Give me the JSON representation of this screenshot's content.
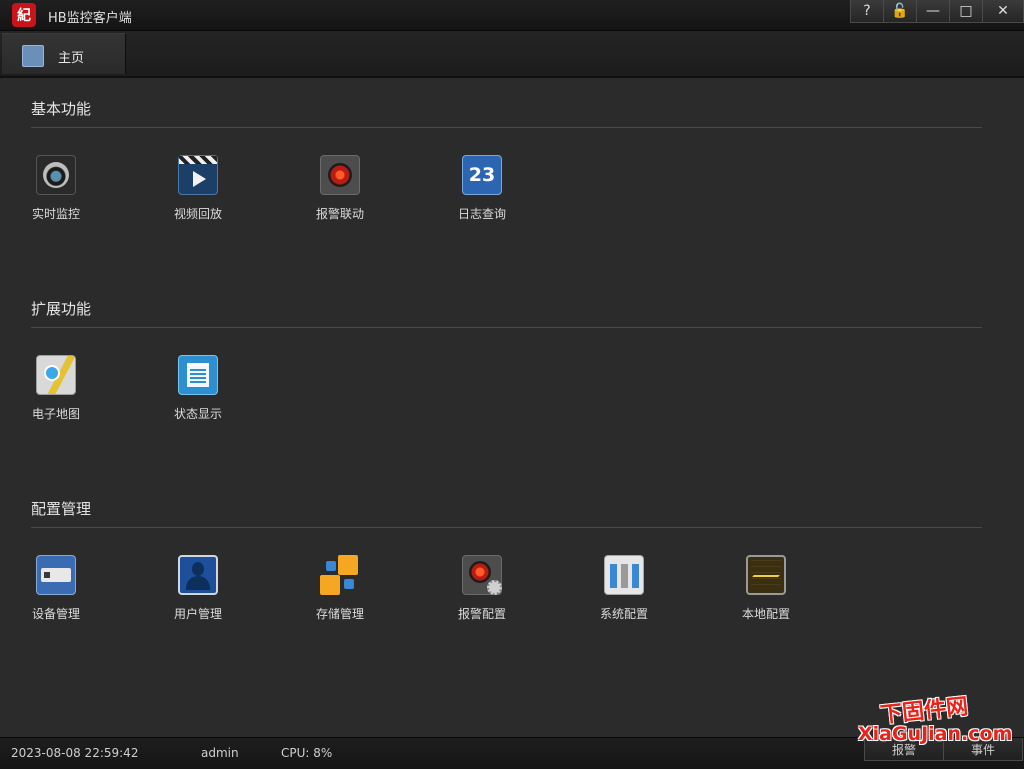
{
  "window": {
    "logo_text": "紀",
    "title": "HB监控客户端",
    "controls": [
      "?",
      "🔓",
      "—",
      "□",
      "✕"
    ]
  },
  "tabs": [
    {
      "label": "主页",
      "icon": "home-icon"
    }
  ],
  "sections": [
    {
      "title": "基本功能",
      "items": [
        {
          "label": "实时监控",
          "icon": "camera-icon"
        },
        {
          "label": "视频回放",
          "icon": "video-playback-icon"
        },
        {
          "label": "报警联动",
          "icon": "alarm-icon"
        },
        {
          "label": "日志查询",
          "icon": "calendar-icon",
          "icon_text": "23"
        }
      ]
    },
    {
      "title": "扩展功能",
      "items": [
        {
          "label": "电子地图",
          "icon": "map-icon"
        },
        {
          "label": "状态显示",
          "icon": "status-icon"
        }
      ]
    },
    {
      "title": "配置管理",
      "items": [
        {
          "label": "设备管理",
          "icon": "device-icon"
        },
        {
          "label": "用户管理",
          "icon": "user-icon"
        },
        {
          "label": "存储管理",
          "icon": "storage-icon"
        },
        {
          "label": "报警配置",
          "icon": "alarm-config-icon"
        },
        {
          "label": "系统配置",
          "icon": "system-config-icon"
        },
        {
          "label": "本地配置",
          "icon": "local-config-icon"
        }
      ]
    }
  ],
  "status": {
    "datetime": "2023-08-08 22:59:42",
    "user": "admin",
    "cpu": "CPU: 8%",
    "buttons": [
      "报警",
      "事件"
    ]
  },
  "watermark": {
    "top": "下固件网",
    "bottom": "XiaGuJian.com"
  }
}
